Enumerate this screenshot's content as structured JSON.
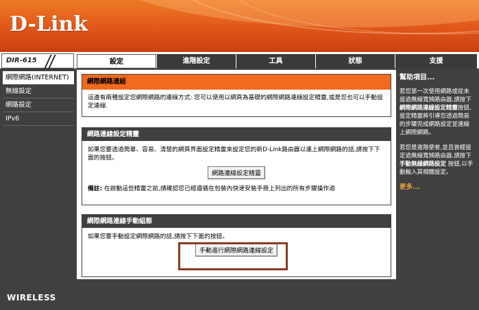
{
  "brand": {
    "logo": "D-Link"
  },
  "nav": {
    "model": "DIR-615",
    "tabs": [
      {
        "label": "設定"
      },
      {
        "label": "進階設定"
      },
      {
        "label": "工具"
      },
      {
        "label": "狀態"
      },
      {
        "label": "支援"
      }
    ]
  },
  "sidebar": {
    "items": [
      {
        "label": "網際網路(INTERNET)"
      },
      {
        "label": "無線設定"
      },
      {
        "label": "網路設定"
      },
      {
        "label": "IPv6"
      }
    ]
  },
  "main": {
    "intro": {
      "title": "網際網路連結",
      "text": "這邊有兩種設定您網際網路的連線方式: 您可以使用以網頁為基礎的網際網路連線設定精靈,或是您也可以手動設定連線."
    },
    "wizard": {
      "title": "網路連線設定精靈",
      "text": "如果您要透過簡單、容易、清楚的網頁界面設定精靈來設定您的新D-Link路由器以連上網際網路的話,請按下下面的按鈕。",
      "button": "網路連線設定精靈",
      "note_label": "備註:",
      "note_text": " 在啟動這些精靈之前,請確認您已經遵循在包裝內快速安裝手冊上列出的所有步驟操作過"
    },
    "manual": {
      "title": "網際網路連線手動組態",
      "text": "如果您要手動設定網際網路的話,請按下下面的按鈕。",
      "button": "手動進行網際網路連線設定"
    }
  },
  "help": {
    "title": "幫助項目...",
    "p1_a": "若您第一次使用網路或從未設過無線寬頻路由器,請按下",
    "p1_b": "網際網路連線設定精靈",
    "p1_c": "按鈕,設定精靈將引導您透過簡易的步驟完成網路設定並連線上網際網路。",
    "p2_a": "若您是進階使者,並且曾經設定過無線寬頻路由器,請按下",
    "p2_b": "手動無線網路設定",
    "p2_c": " 按鈕,以手動輸入其相關設定。",
    "more": "更多..."
  },
  "footer": {
    "brand": "WIRELESS"
  },
  "colors": {
    "orange": "#f26a1e",
    "dark": "#404040",
    "highlight": "#8a3a22"
  }
}
